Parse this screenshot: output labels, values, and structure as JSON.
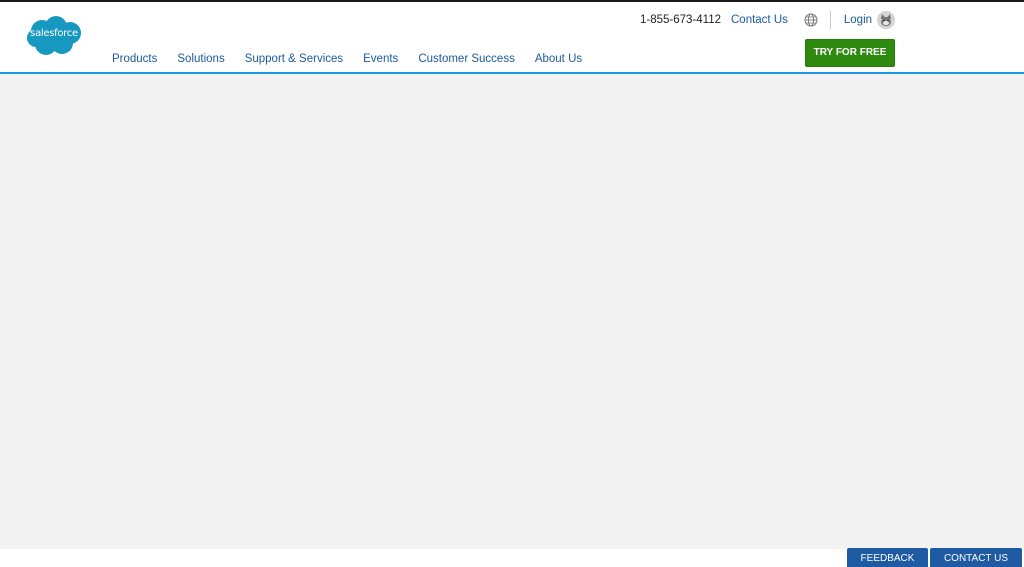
{
  "brand": {
    "logo_text": "salesforce",
    "logo_color": "#1798c1"
  },
  "utility": {
    "phone": "1-855-673-4112",
    "contact_label": "Contact Us",
    "login_label": "Login"
  },
  "nav": {
    "items": [
      {
        "label": "Products"
      },
      {
        "label": "Solutions"
      },
      {
        "label": "Support & Services"
      },
      {
        "label": "Events"
      },
      {
        "label": "Customer Success"
      },
      {
        "label": "About Us"
      }
    ]
  },
  "cta": {
    "try_label": "TRY FOR FREE",
    "color": "#2e8b0f"
  },
  "footer": {
    "feedback_label": "FEEDBACK",
    "contact_label": "CONTACT US",
    "color": "#1e5ba3"
  },
  "icons": {
    "globe": "globe-icon",
    "avatar": "user-avatar-icon"
  }
}
